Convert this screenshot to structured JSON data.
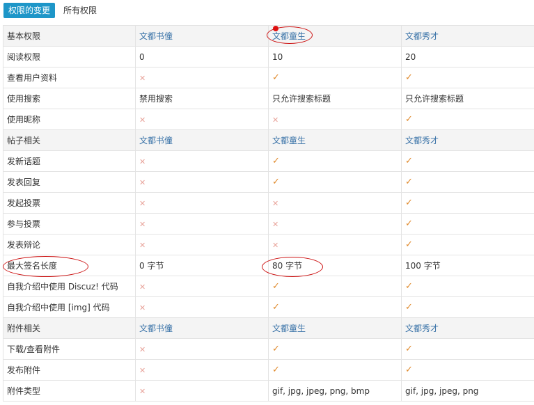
{
  "tabs": [
    {
      "label": "权限的变更",
      "active": true
    },
    {
      "label": "所有权限",
      "active": false
    }
  ],
  "icons": {
    "yes": "✓",
    "no": "✕",
    "yes_color": "#e08a2c",
    "no_color": "#e8a39a"
  },
  "rows": [
    {
      "type": "section",
      "cells": [
        "基本权限",
        "文都书僮",
        "文都童生",
        "文都秀才"
      ]
    },
    {
      "type": "row",
      "cells": [
        "阅读权限",
        "0",
        "10",
        "20"
      ]
    },
    {
      "type": "row",
      "cells": [
        "查看用户资料",
        "no",
        "yes",
        "yes"
      ]
    },
    {
      "type": "row",
      "cells": [
        "使用搜索",
        "禁用搜索",
        "只允许搜索标题",
        "只允许搜索标题"
      ]
    },
    {
      "type": "row",
      "cells": [
        "使用昵称",
        "no",
        "no",
        "yes"
      ]
    },
    {
      "type": "section",
      "cells": [
        "帖子相关",
        "文都书僮",
        "文都童生",
        "文都秀才"
      ]
    },
    {
      "type": "row",
      "cells": [
        "发新话题",
        "no",
        "yes",
        "yes"
      ]
    },
    {
      "type": "row",
      "cells": [
        "发表回复",
        "no",
        "yes",
        "yes"
      ]
    },
    {
      "type": "row",
      "cells": [
        "发起投票",
        "no",
        "no",
        "yes"
      ]
    },
    {
      "type": "row",
      "cells": [
        "参与投票",
        "no",
        "no",
        "yes"
      ]
    },
    {
      "type": "row",
      "cells": [
        "发表辩论",
        "no",
        "no",
        "yes"
      ]
    },
    {
      "type": "row",
      "cells": [
        "最大签名长度",
        "0 字节",
        "80 字节",
        "100 字节"
      ]
    },
    {
      "type": "row",
      "cells": [
        "自我介绍中使用 Discuz! 代码",
        "no",
        "yes",
        "yes"
      ]
    },
    {
      "type": "row",
      "cells": [
        "自我介绍中使用 [img] 代码",
        "no",
        "yes",
        "yes"
      ]
    },
    {
      "type": "section",
      "cells": [
        "附件相关",
        "文都书僮",
        "文都童生",
        "文都秀才"
      ]
    },
    {
      "type": "row",
      "cells": [
        "下载/查看附件",
        "no",
        "yes",
        "yes"
      ]
    },
    {
      "type": "row",
      "cells": [
        "发布附件",
        "no",
        "yes",
        "yes"
      ]
    },
    {
      "type": "row",
      "cells": [
        "附件类型",
        "no",
        "gif, jpg, jpeg, png, bmp",
        "gif, jpg, jpeg, png"
      ]
    }
  ]
}
